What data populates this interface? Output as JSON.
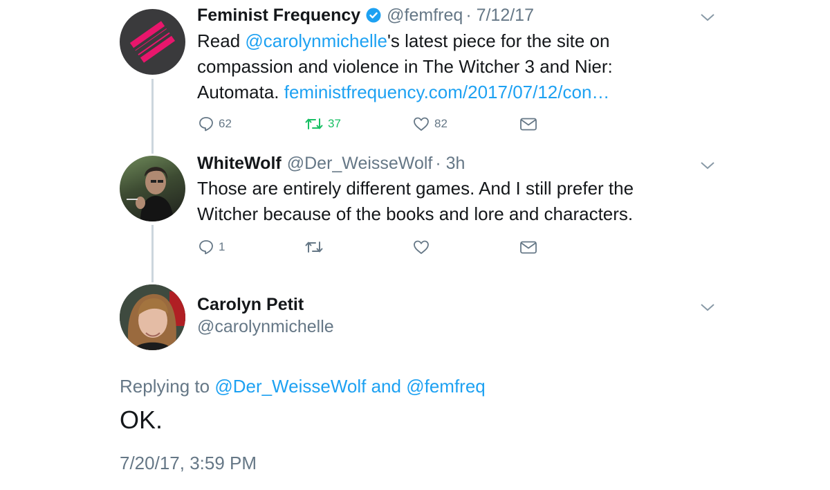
{
  "tweets": [
    {
      "name": "Feminist Frequency",
      "verified": true,
      "handle": "@femfreq",
      "time": "· 7/12/17",
      "text_lines": [
        {
          "pre": "Read ",
          "link": "@carolynmichelle",
          "post": "'s latest piece for the site on"
        },
        {
          "pre": "compassion and violence in The Witcher 3 and Nier:",
          "link": "",
          "post": ""
        },
        {
          "pre": "Automata. ",
          "link": "feministfrequency.com/2017/07/12/con…",
          "post": ""
        }
      ],
      "replies": "62",
      "retweets": "37",
      "likes": "82",
      "avatar": "feminist-frequency-logo",
      "accent": "#e8166c"
    },
    {
      "name": "WhiteWolf",
      "handle": "@Der_WeisseWolf",
      "time": "· 3h",
      "text_lines": [
        "Those are entirely different games. And I still prefer the",
        "Witcher because of the books and lore and characters."
      ],
      "replies": "1",
      "avatar": "user-photo"
    }
  ],
  "main_tweet": {
    "name": "Carolyn Petit",
    "handle": "@carolynmichelle",
    "replying_prefix": "Replying to",
    "replying_user1": "@Der_WeisseWolf",
    "replying_and": "and",
    "replying_user2": "@femfreq",
    "text": "OK.",
    "timestamp": "7/20/17, 3:59 PM",
    "avatar": "user-photo"
  },
  "colors": {
    "link": "#1da1f2",
    "muted": "#657786",
    "retweet_active": "#17bf63",
    "verified": "#1da1f2"
  }
}
